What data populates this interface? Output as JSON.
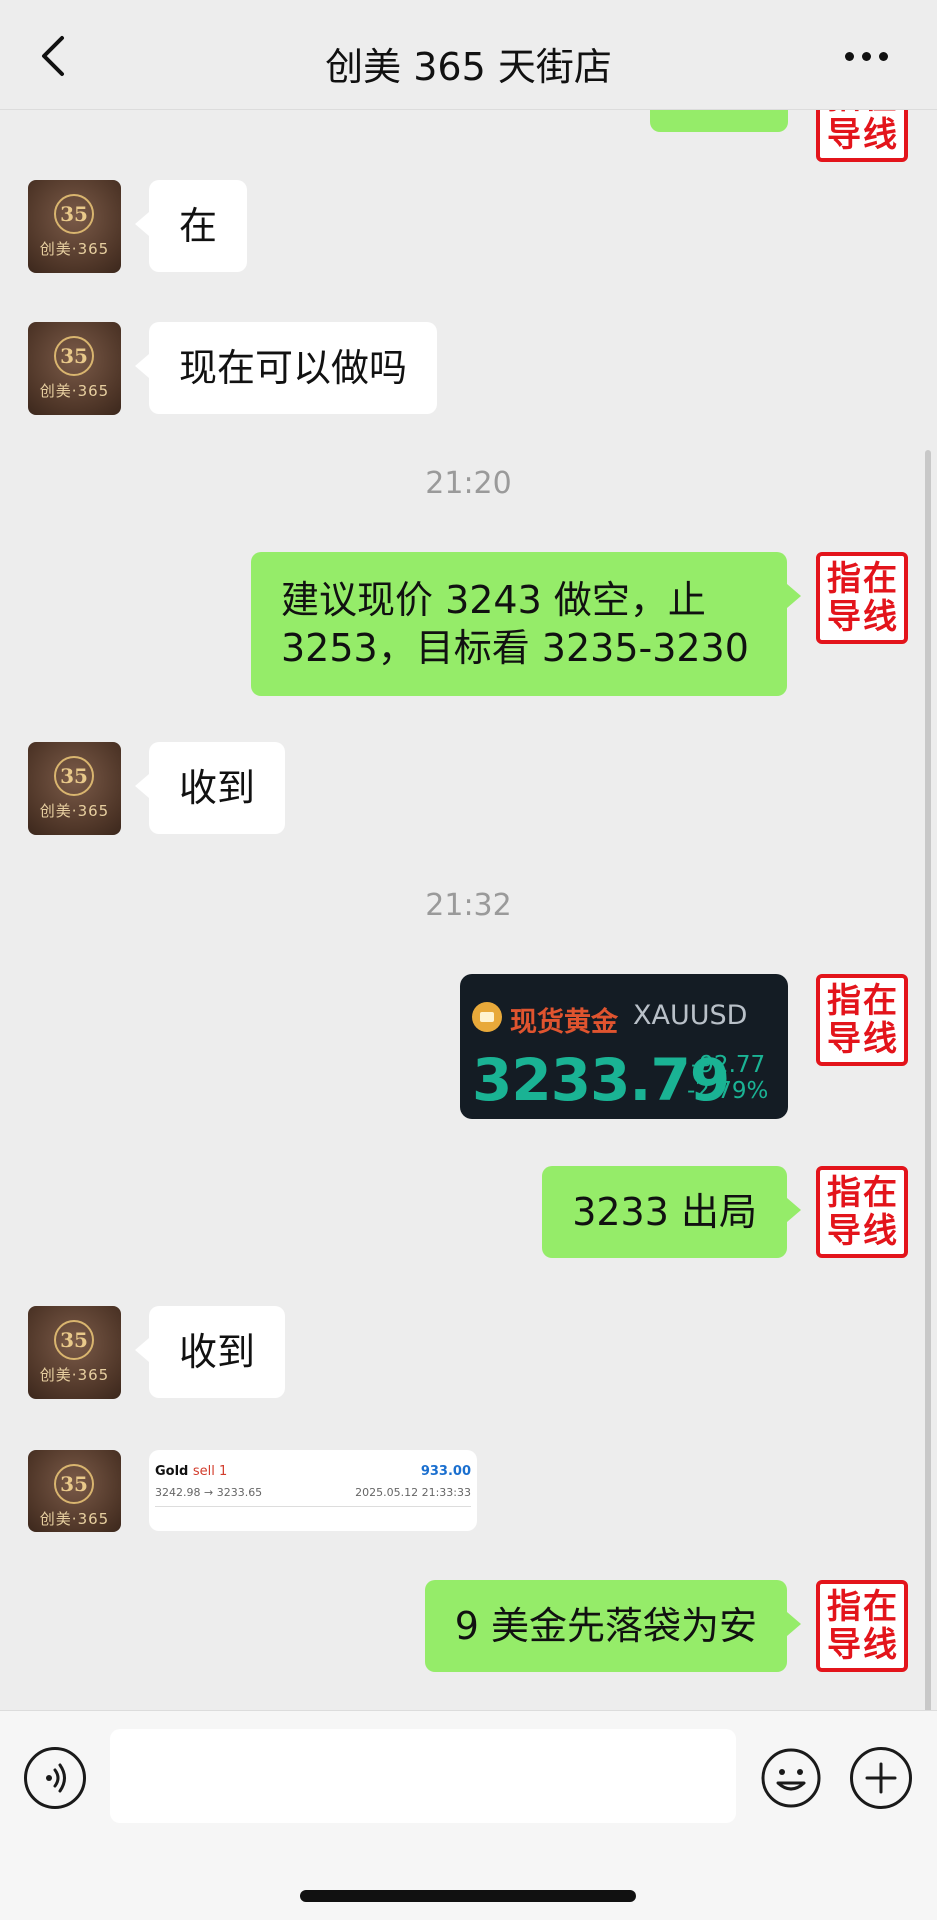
{
  "header": {
    "title": "创美 365 天街店"
  },
  "avatar_left": {
    "logo": "35",
    "label": "创美·365"
  },
  "avatar_right": {
    "chars": [
      "指",
      "在",
      "导",
      "线"
    ]
  },
  "messages": [
    {
      "text": "在"
    },
    {
      "text": "现在可以做吗"
    },
    {
      "time": "21:20"
    },
    {
      "line1": "建议现价 3243 做空，止",
      "line2": "3253，目标看 3235-3230"
    },
    {
      "text": "收到"
    },
    {
      "time": "21:32"
    },
    {
      "gold": {
        "name": "现货黄金",
        "symbol": "XAUUSD",
        "price": "3233.79",
        "change": "-92.77",
        "change_pct": "-2.79%"
      }
    },
    {
      "text": "3233 出局"
    },
    {
      "text": "收到"
    },
    {
      "trade": {
        "symbol": "Gold",
        "side": "sell 1",
        "profit": "933.00",
        "prices": "3242.98 → 3233.65",
        "datetime": "2025.05.12 21:33:33"
      }
    },
    {
      "text": "9 美金先落袋为安"
    }
  ]
}
